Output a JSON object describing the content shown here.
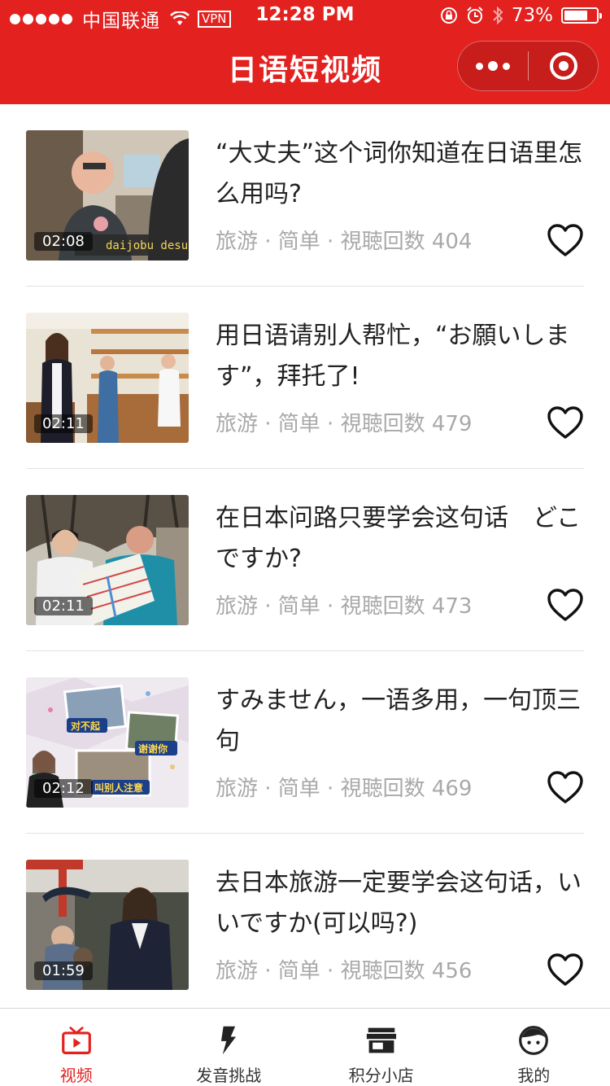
{
  "status_bar": {
    "carrier": "中国联通",
    "vpn": "VPN",
    "time": "12:28 PM",
    "battery": "73%",
    "battery_level": 0.73
  },
  "header": {
    "title": "日语短视频"
  },
  "videos": [
    {
      "duration": "02:08",
      "title": "“大丈夫”这个词你知道在日语里怎么用吗?",
      "meta": "旅游 · 简单 · 視聴回数 404",
      "thumb_caption": "daijobu desu ka?"
    },
    {
      "duration": "02:11",
      "title": "用日语请别人帮忙，“お願いします”，拜托了!",
      "meta": "旅游 · 简单 · 視聴回数 479"
    },
    {
      "duration": "02:11",
      "title": "在日本问路只要学会这句话　どこですか?",
      "meta": "旅游 · 简单 · 視聴回数 473"
    },
    {
      "duration": "02:12",
      "title": "すみません，一语多用，一句顶三句",
      "meta": "旅游 · 简单 · 視聴回数 469",
      "thumb_tags": [
        "对不起",
        "谢谢你",
        "叫别人注意"
      ]
    },
    {
      "duration": "01:59",
      "title": "去日本旅游一定要学会这句话，いいですか(可以吗?)",
      "meta": "旅游 · 简单 · 視聴回数 456"
    }
  ],
  "tabbar": {
    "items": [
      {
        "label": "视频",
        "icon": "tv-icon",
        "active": true
      },
      {
        "label": "发音挑战",
        "icon": "lightning-icon",
        "active": false
      },
      {
        "label": "积分小店",
        "icon": "store-icon",
        "active": false
      },
      {
        "label": "我的",
        "icon": "face-icon",
        "active": false
      }
    ]
  },
  "colors": {
    "brand": "#e3211f",
    "meta_text": "#a9a9a9",
    "divider": "#e2e2e2"
  }
}
